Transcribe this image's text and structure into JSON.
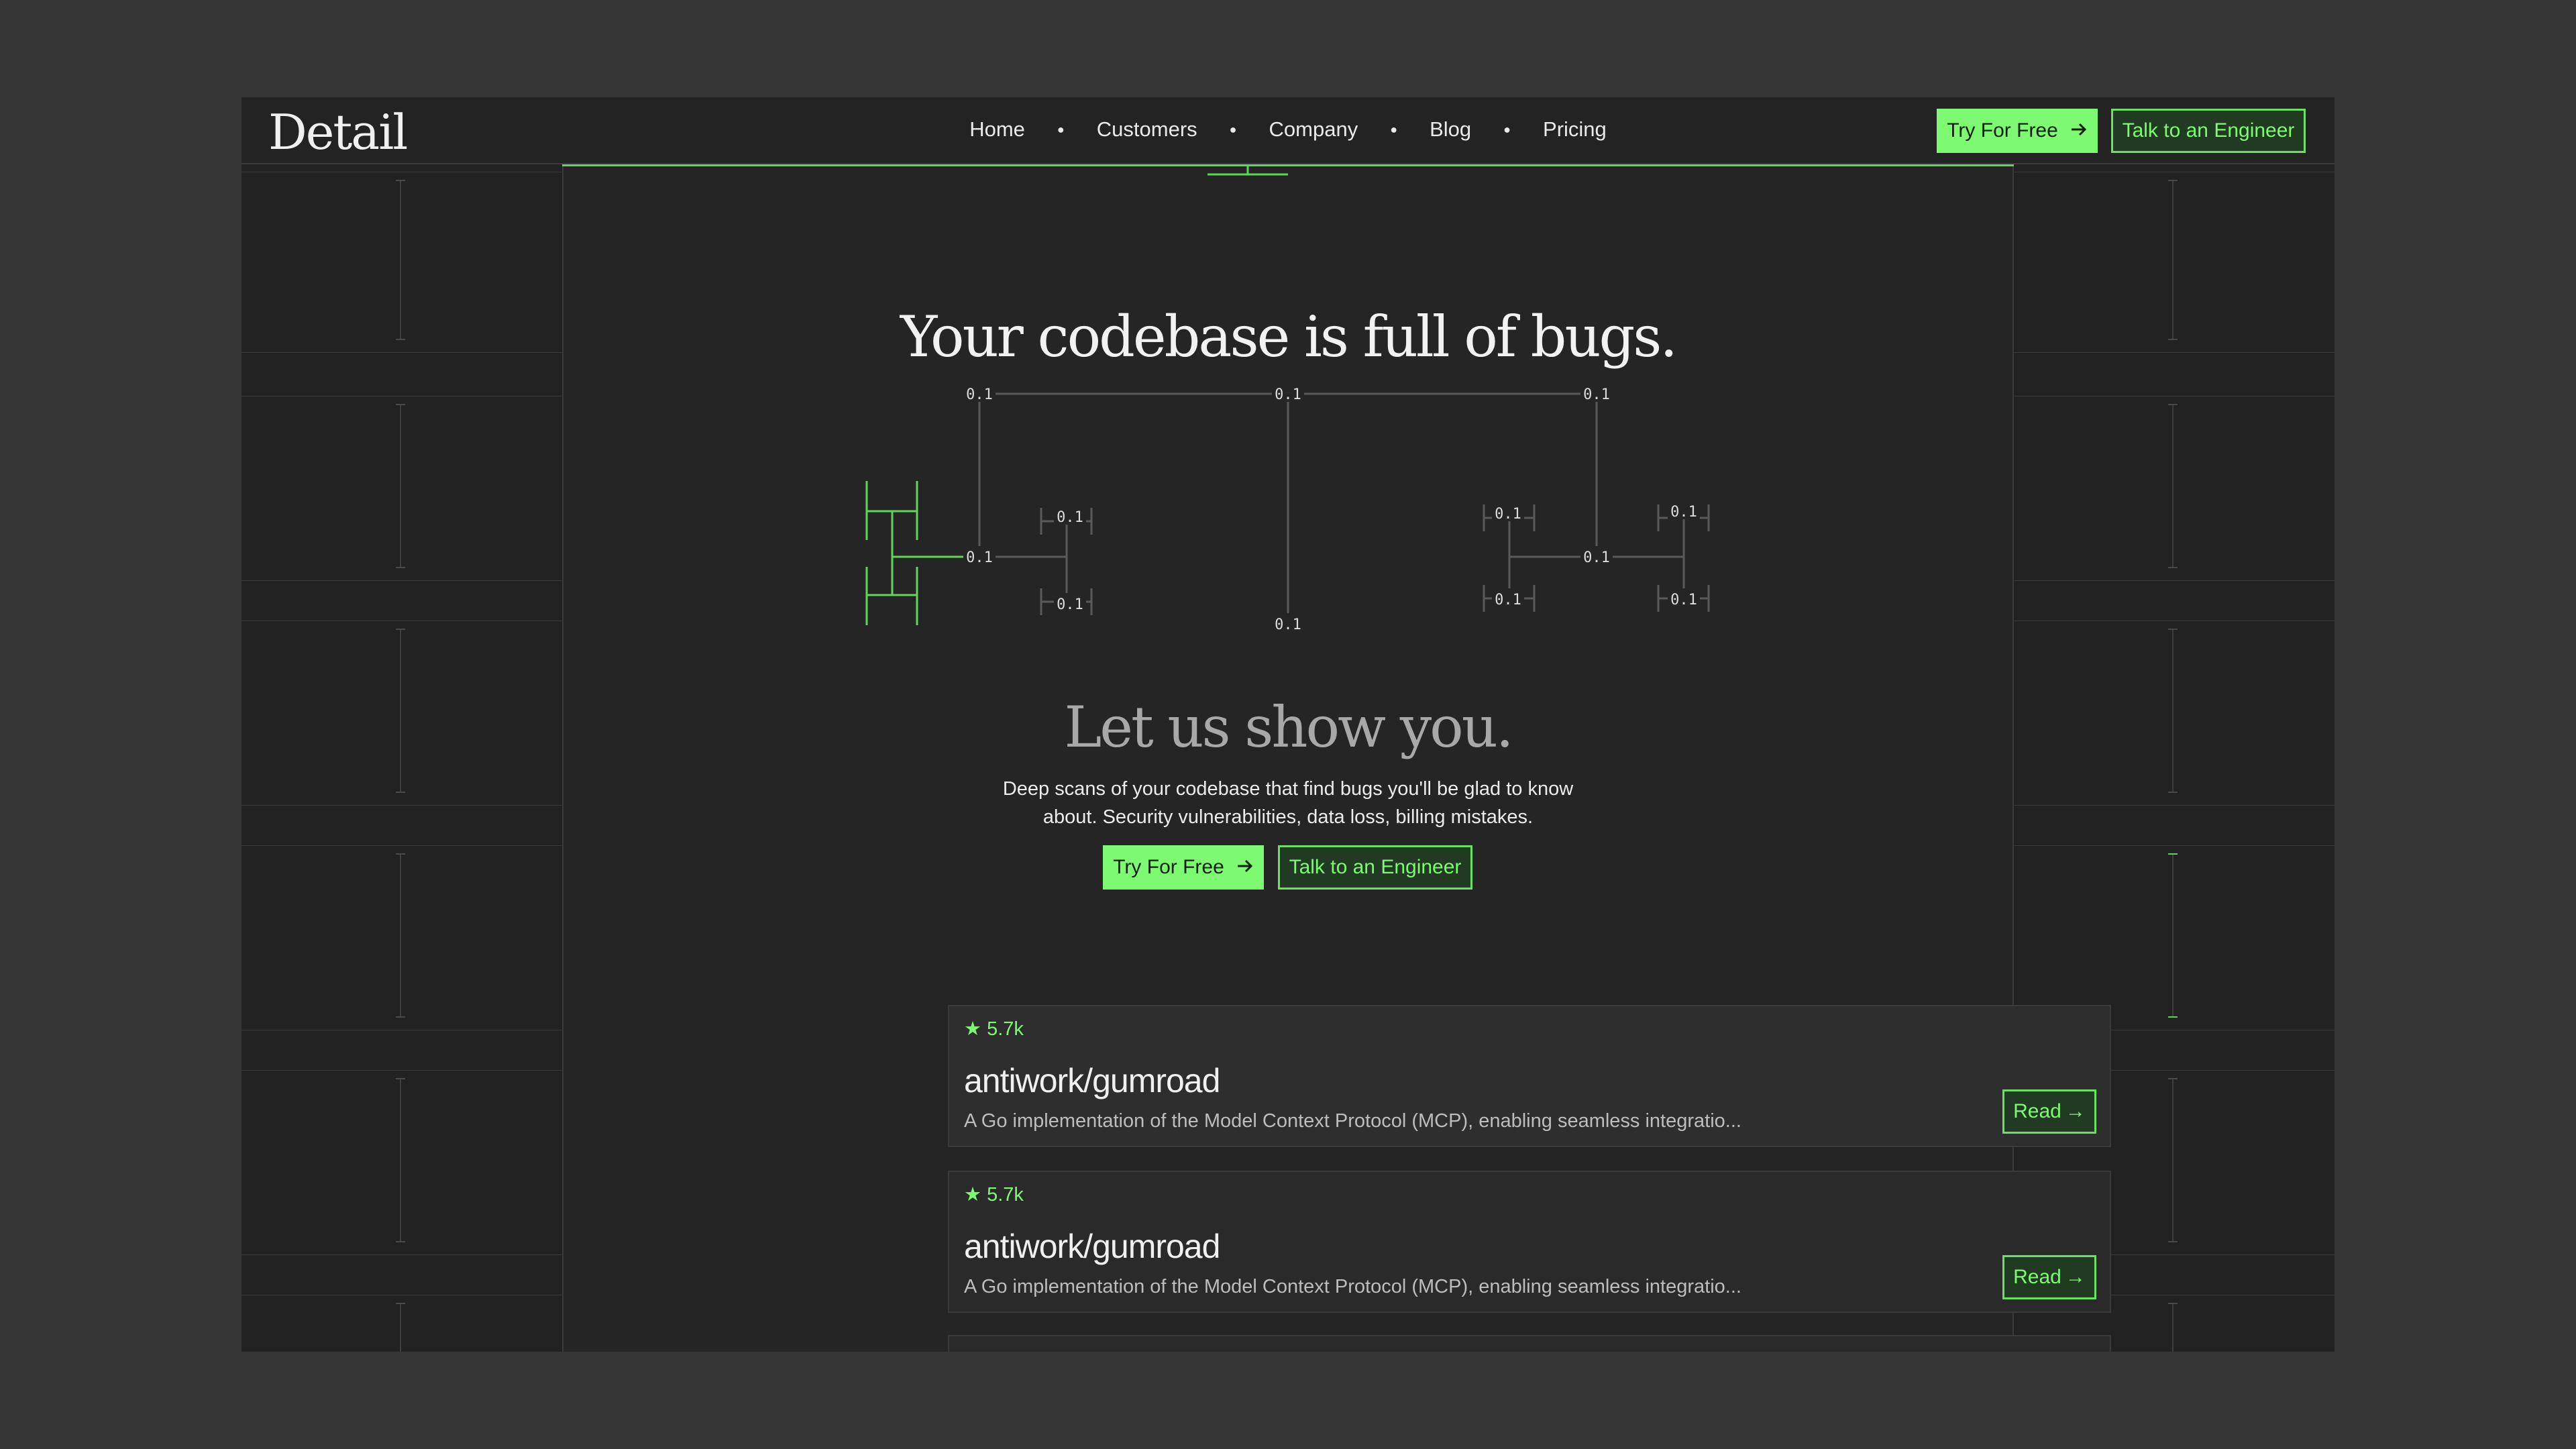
{
  "nav": {
    "logo": "Detail",
    "links": [
      "Home",
      "Customers",
      "Company",
      "Blog",
      "Pricing"
    ],
    "try_label": "Try For Free",
    "talk_label": "Talk to an Engineer"
  },
  "hero": {
    "headline": "Your codebase is full of bugs.",
    "subhead": "Let us show you.",
    "description": "Deep scans of your codebase that find bugs you'll be glad to know about. Security vulnerabilities, data loss, billing mistakes.",
    "try_label": "Try For Free",
    "talk_label": "Talk to an Engineer"
  },
  "tree_label": "0.1",
  "repos": [
    {
      "stars": "5.7k",
      "name": "antiwork/gumroad",
      "description": "A Go implementation of the Model Context Protocol (MCP), enabling seamless integratio...",
      "read_label": "Read"
    },
    {
      "stars": "5.7k",
      "name": "antiwork/gumroad",
      "description": "A Go implementation of the Model Context Protocol (MCP), enabling seamless integratio...",
      "read_label": "Read"
    }
  ],
  "colors": {
    "accent": "#7dfa72",
    "background": "#252525",
    "outer": "#363636"
  },
  "icons": {
    "arrow": "arrow-right-icon",
    "star": "star-icon"
  }
}
